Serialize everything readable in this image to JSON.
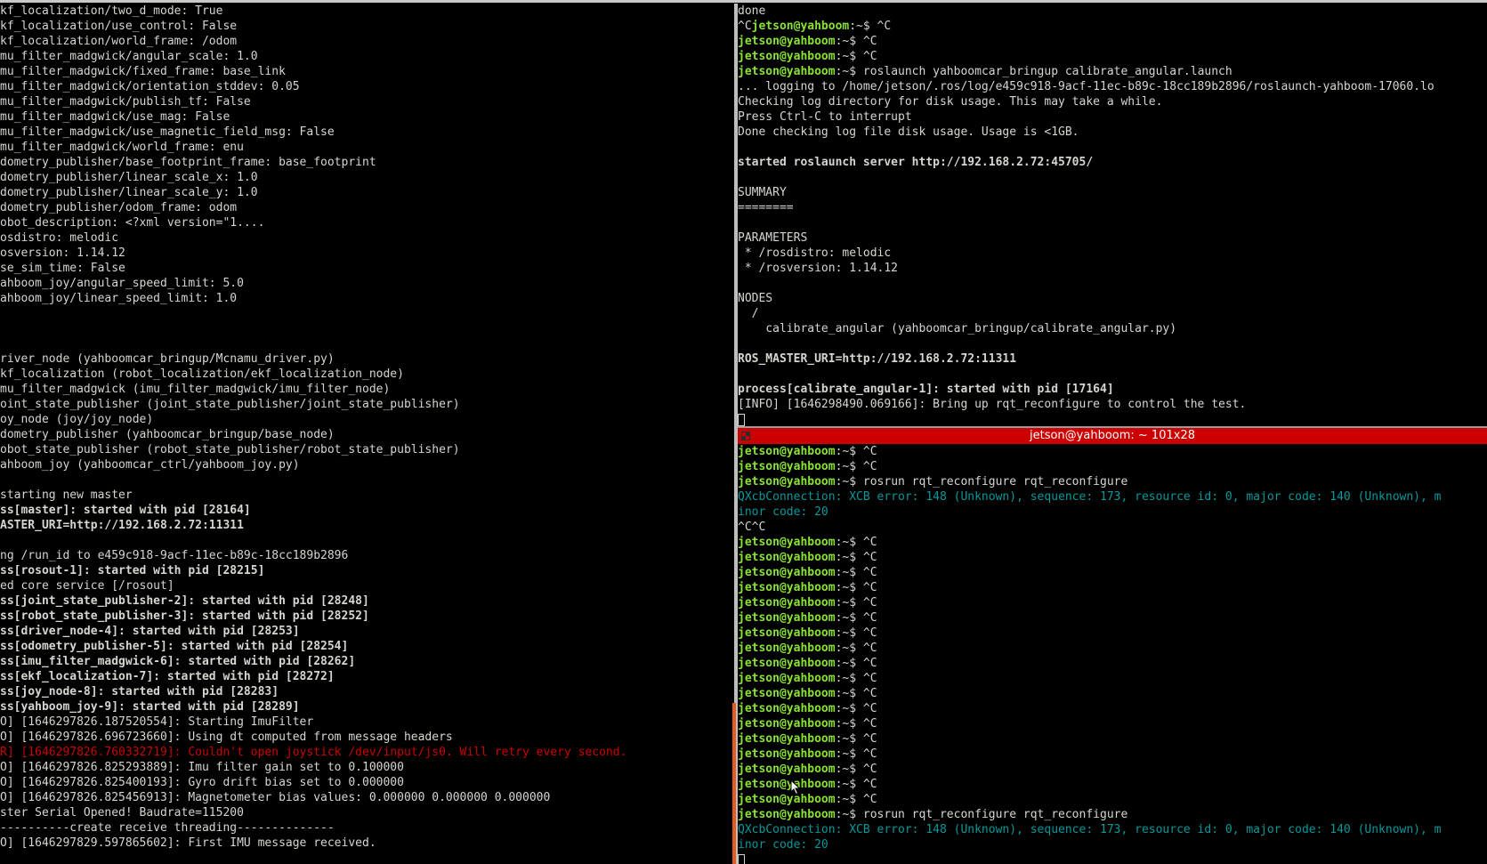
{
  "colors": {
    "prompt": "#8ae234",
    "error_cyan": "#06989a",
    "error_red": "#cc0000",
    "title_bar": "#cc0000"
  },
  "left": {
    "lines": [
      "kf_localization/two_d_mode: True",
      "kf_localization/use_control: False",
      "kf_localization/world_frame: /odom",
      "mu_filter_madgwick/angular_scale: 1.0",
      "mu_filter_madgwick/fixed_frame: base_link",
      "mu_filter_madgwick/orientation_stddev: 0.05",
      "mu_filter_madgwick/publish_tf: False",
      "mu_filter_madgwick/use_mag: False",
      "mu_filter_madgwick/use_magnetic_field_msg: False",
      "mu_filter_madgwick/world_frame: enu",
      "dometry_publisher/base_footprint_frame: base_footprint",
      "dometry_publisher/linear_scale_x: 1.0",
      "dometry_publisher/linear_scale_y: 1.0",
      "dometry_publisher/odom_frame: odom",
      "obot_description: <?xml version=\"1....",
      "osdistro: melodic",
      "osversion: 1.14.12",
      "se_sim_time: False",
      "ahboom_joy/angular_speed_limit: 5.0",
      "ahboom_joy/linear_speed_limit: 1.0",
      "",
      "",
      "",
      "river_node (yahboomcar_bringup/Mcnamu_driver.py)",
      "kf_localization (robot_localization/ekf_localization_node)",
      "mu_filter_madgwick (imu_filter_madgwick/imu_filter_node)",
      "oint_state_publisher (joint_state_publisher/joint_state_publisher)",
      "oy_node (joy/joy_node)",
      "dometry_publisher (yahboomcar_bringup/base_node)",
      "obot_state_publisher (robot_state_publisher/robot_state_publisher)",
      "ahboom_joy (yahboomcar_ctrl/yahboom_joy.py)",
      "",
      "starting new master",
      "ss[master]: started with pid [28164]",
      "ASTER_URI=http://192.168.2.72:11311",
      "",
      "ng /run_id to e459c918-9acf-11ec-b89c-18cc189b2896",
      "ss[rosout-1]: started with pid [28215]",
      "ed core service [/rosout]",
      "ss[joint_state_publisher-2]: started with pid [28248]",
      "ss[robot_state_publisher-3]: started with pid [28252]",
      "ss[driver_node-4]: started with pid [28253]",
      "ss[odometry_publisher-5]: started with pid [28254]",
      "ss[imu_filter_madgwick-6]: started with pid [28262]",
      "ss[ekf_localization-7]: started with pid [28272]",
      "ss[joy_node-8]: started with pid [28283]",
      "ss[yahboom_joy-9]: started with pid [28289]",
      "O] [1646297826.187520554]: Starting ImuFilter",
      "O] [1646297826.696723660]: Using dt computed from message headers",
      "R] [1646297826.760332719]: Couldn't open joystick /dev/input/js0. Will retry every second.",
      "O] [1646297826.825293889]: Imu filter gain set to 0.100000",
      "O] [1646297826.825400193]: Gyro drift bias set to 0.000000",
      "O] [1646297826.825456913]: Magnetometer bias values: 0.000000 0.000000 0.000000",
      "ster Serial Opened! Baudrate=115200",
      "----------create receive threading--------------",
      "O] [1646297829.597865602]: First IMU message received."
    ]
  },
  "top_right": {
    "lines": [
      {
        "t": "done"
      },
      {
        "pre": "^C",
        "prompt": "jetson@yahboom",
        "t": ":~$ ^C"
      },
      {
        "prompt": "jetson@yahboom",
        "t": ":~$ ^C"
      },
      {
        "prompt": "jetson@yahboom",
        "t": ":~$ ^C"
      },
      {
        "prompt": "jetson@yahboom",
        "t": ":~$ roslaunch yahboomcar_bringup calibrate_angular.launch"
      },
      {
        "t": "... logging to /home/jetson/.ros/log/e459c918-9acf-11ec-b89c-18cc189b2896/roslaunch-yahboom-17060.lo"
      },
      {
        "t": "Checking log directory for disk usage. This may take a while."
      },
      {
        "t": "Press Ctrl-C to interrupt"
      },
      {
        "t": "Done checking log file disk usage. Usage is <1GB."
      },
      {
        "t": ""
      },
      {
        "t": "started roslaunch server http://192.168.2.72:45705/",
        "bold": true
      },
      {
        "t": ""
      },
      {
        "t": "SUMMARY"
      },
      {
        "t": "========"
      },
      {
        "t": ""
      },
      {
        "t": "PARAMETERS"
      },
      {
        "t": " * /rosdistro: melodic"
      },
      {
        "t": " * /rosversion: 1.14.12"
      },
      {
        "t": ""
      },
      {
        "t": "NODES"
      },
      {
        "t": "  /"
      },
      {
        "t": "    calibrate_angular (yahboomcar_bringup/calibrate_angular.py)"
      },
      {
        "t": ""
      },
      {
        "t": "ROS_MASTER_URI=http://192.168.2.72:11311",
        "bold": true
      },
      {
        "t": ""
      },
      {
        "t": "process[calibrate_angular-1]: started with pid [17164]",
        "bold": true
      },
      {
        "t": "[INFO] [1646298490.069166]: Bring up rqt_reconfigure to control the test."
      },
      {
        "cursor": true,
        "t": ""
      }
    ]
  },
  "bottom_right": {
    "title": "jetson@yahboom: ~ 101x28",
    "lines": [
      {
        "prompt": "jetson@yahboom",
        "t": ":~$ ^C"
      },
      {
        "prompt": "jetson@yahboom",
        "t": ":~$ ^C"
      },
      {
        "prompt": "jetson@yahboom",
        "t": ":~$ rosrun rqt_reconfigure rqt_reconfigure"
      },
      {
        "t": "QXcbConnection: XCB error: 148 (Unknown), sequence: 173, resource id: 0, major code: 140 (Unknown), m",
        "cyan": true
      },
      {
        "t": "inor code: 20",
        "cyan": true
      },
      {
        "t": "^C^C"
      },
      {
        "prompt": "jetson@yahboom",
        "t": ":~$ ^C"
      },
      {
        "prompt": "jetson@yahboom",
        "t": ":~$ ^C"
      },
      {
        "prompt": "jetson@yahboom",
        "t": ":~$ ^C"
      },
      {
        "prompt": "jetson@yahboom",
        "t": ":~$ ^C"
      },
      {
        "prompt": "jetson@yahboom",
        "t": ":~$ ^C"
      },
      {
        "prompt": "jetson@yahboom",
        "t": ":~$ ^C"
      },
      {
        "prompt": "jetson@yahboom",
        "t": ":~$ ^C"
      },
      {
        "prompt": "jetson@yahboom",
        "t": ":~$ ^C"
      },
      {
        "prompt": "jetson@yahboom",
        "t": ":~$ ^C"
      },
      {
        "prompt": "jetson@yahboom",
        "t": ":~$ ^C"
      },
      {
        "prompt": "jetson@yahboom",
        "t": ":~$ ^C"
      },
      {
        "prompt": "jetson@yahboom",
        "t": ":~$ ^C"
      },
      {
        "prompt": "jetson@yahboom",
        "t": ":~$ ^C"
      },
      {
        "prompt": "jetson@yahboom",
        "t": ":~$ ^C"
      },
      {
        "prompt": "jetson@yahboom",
        "t": ":~$ ^C"
      },
      {
        "prompt": "jetson@yahboom",
        "t": ":~$ ^C"
      },
      {
        "prompt": "jetson@yahboom",
        "t": ":~$ ^C"
      },
      {
        "prompt": "jetson@yahboom",
        "t": ":~$ ^C"
      },
      {
        "prompt": "jetson@yahboom",
        "t": ":~$ rosrun rqt_reconfigure rqt_reconfigure"
      },
      {
        "t": "QXcbConnection: XCB error: 148 (Unknown), sequence: 173, resource id: 0, major code: 140 (Unknown), m",
        "cyan": true
      },
      {
        "t": "inor code: 20",
        "cyan": true
      },
      {
        "cursor": true,
        "t": ""
      }
    ]
  }
}
